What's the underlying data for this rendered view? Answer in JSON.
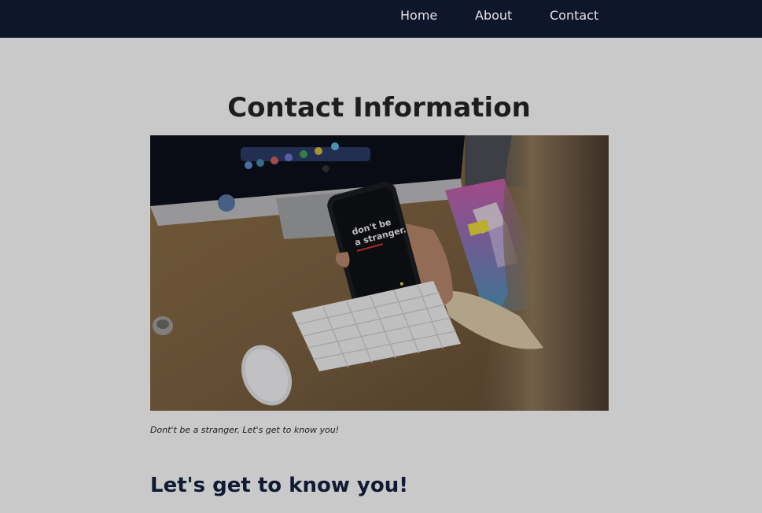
{
  "nav": {
    "items": [
      {
        "label": "Home"
      },
      {
        "label": "About"
      },
      {
        "label": "Contact"
      }
    ]
  },
  "main": {
    "title": "Contact Information",
    "photo": {
      "phone_text_line1": "don't be",
      "phone_text_line2": "a stranger."
    },
    "caption": "Dont't be a stranger, Let's get to know you!",
    "section_heading": "Let's get to know you!"
  },
  "colors": {
    "navbar_bg": "#0e162c",
    "page_bg": "#c9c9c9",
    "nav_text": "#e3e3e3",
    "heading_dark": "#111a33"
  }
}
